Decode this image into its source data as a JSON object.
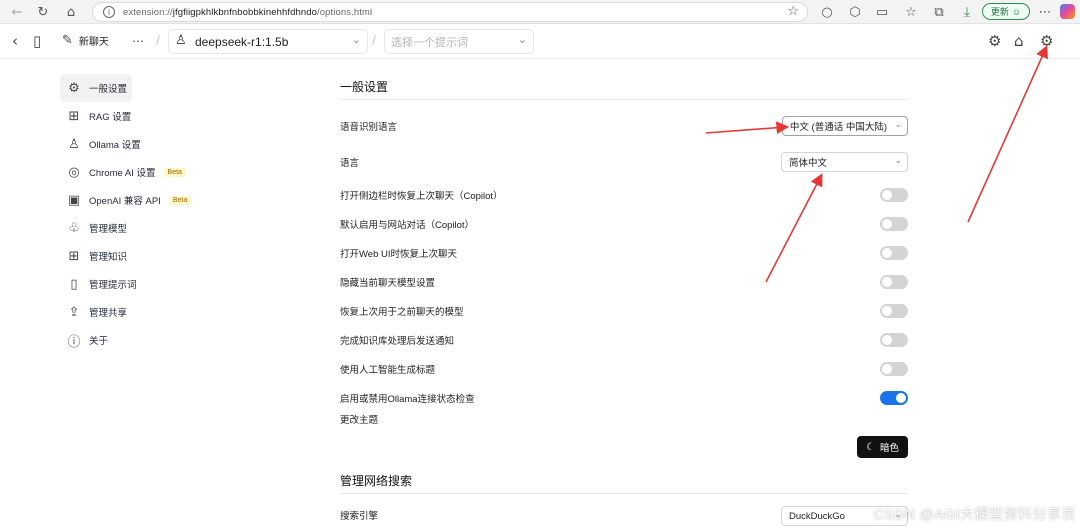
{
  "browser": {
    "url_prefix": "extension://",
    "url_host": "jfgfiigpkhlkbnfnbobbkinehhfdhndo",
    "url_path": "/options.html",
    "update_label": "更新"
  },
  "header": {
    "new_chat_label": "新聊天",
    "model_value": "deepseek-r1:1.5b",
    "prompt_placeholder": "选择一个提示词"
  },
  "sidebar": {
    "items": [
      {
        "label": "一般设置",
        "icon": "settings-cog-icon"
      },
      {
        "label": "RAG 设置",
        "icon": "rag-grid-icon"
      },
      {
        "label": "Ollama 设置",
        "icon": "llama-icon"
      },
      {
        "label": "Chrome AI 设置",
        "icon": "chrome-icon",
        "badge": "Beta"
      },
      {
        "label": "OpenAI 兼容 API",
        "icon": "chip-icon",
        "badge": "Beta"
      },
      {
        "label": "管理模型",
        "icon": "brain-icon"
      },
      {
        "label": "管理知识",
        "icon": "blocks-icon"
      },
      {
        "label": "管理提示词",
        "icon": "book-icon"
      },
      {
        "label": "管理共享",
        "icon": "share-icon"
      },
      {
        "label": "关于",
        "icon": "info-icon"
      }
    ]
  },
  "main": {
    "general_title": "一般设置",
    "speech_lang_label": "语音识别语言",
    "speech_lang_value": "中文 (普通话 中国大陆)",
    "lang_label": "语言",
    "lang_value": "简体中文",
    "toggles": [
      {
        "label": "打开侧边栏时恢复上次聊天（Copilot）",
        "on": false
      },
      {
        "label": "默认启用与网站对话（Copilot）",
        "on": false
      },
      {
        "label": "打开Web UI时恢复上次聊天",
        "on": false
      },
      {
        "label": "隐藏当前聊天模型设置",
        "on": false
      },
      {
        "label": "恢复上次用于之前聊天的模型",
        "on": false
      },
      {
        "label": "完成知识库处理后发送通知",
        "on": false
      },
      {
        "label": "使用人工智能生成标题",
        "on": false
      },
      {
        "label": "启用或禁用Ollama连接状态检查",
        "on": true
      }
    ],
    "theme_label": "更改主题",
    "theme_button": "暗色",
    "web_search_title": "管理网络搜索",
    "search_engine_label": "搜索引擎",
    "search_engine_value": "DuckDuckGo"
  },
  "watermark": "CSDN @AGI大模型资料分享员",
  "colors": {
    "toggle_on": "#1a73e8",
    "arrow": "#e53935"
  }
}
